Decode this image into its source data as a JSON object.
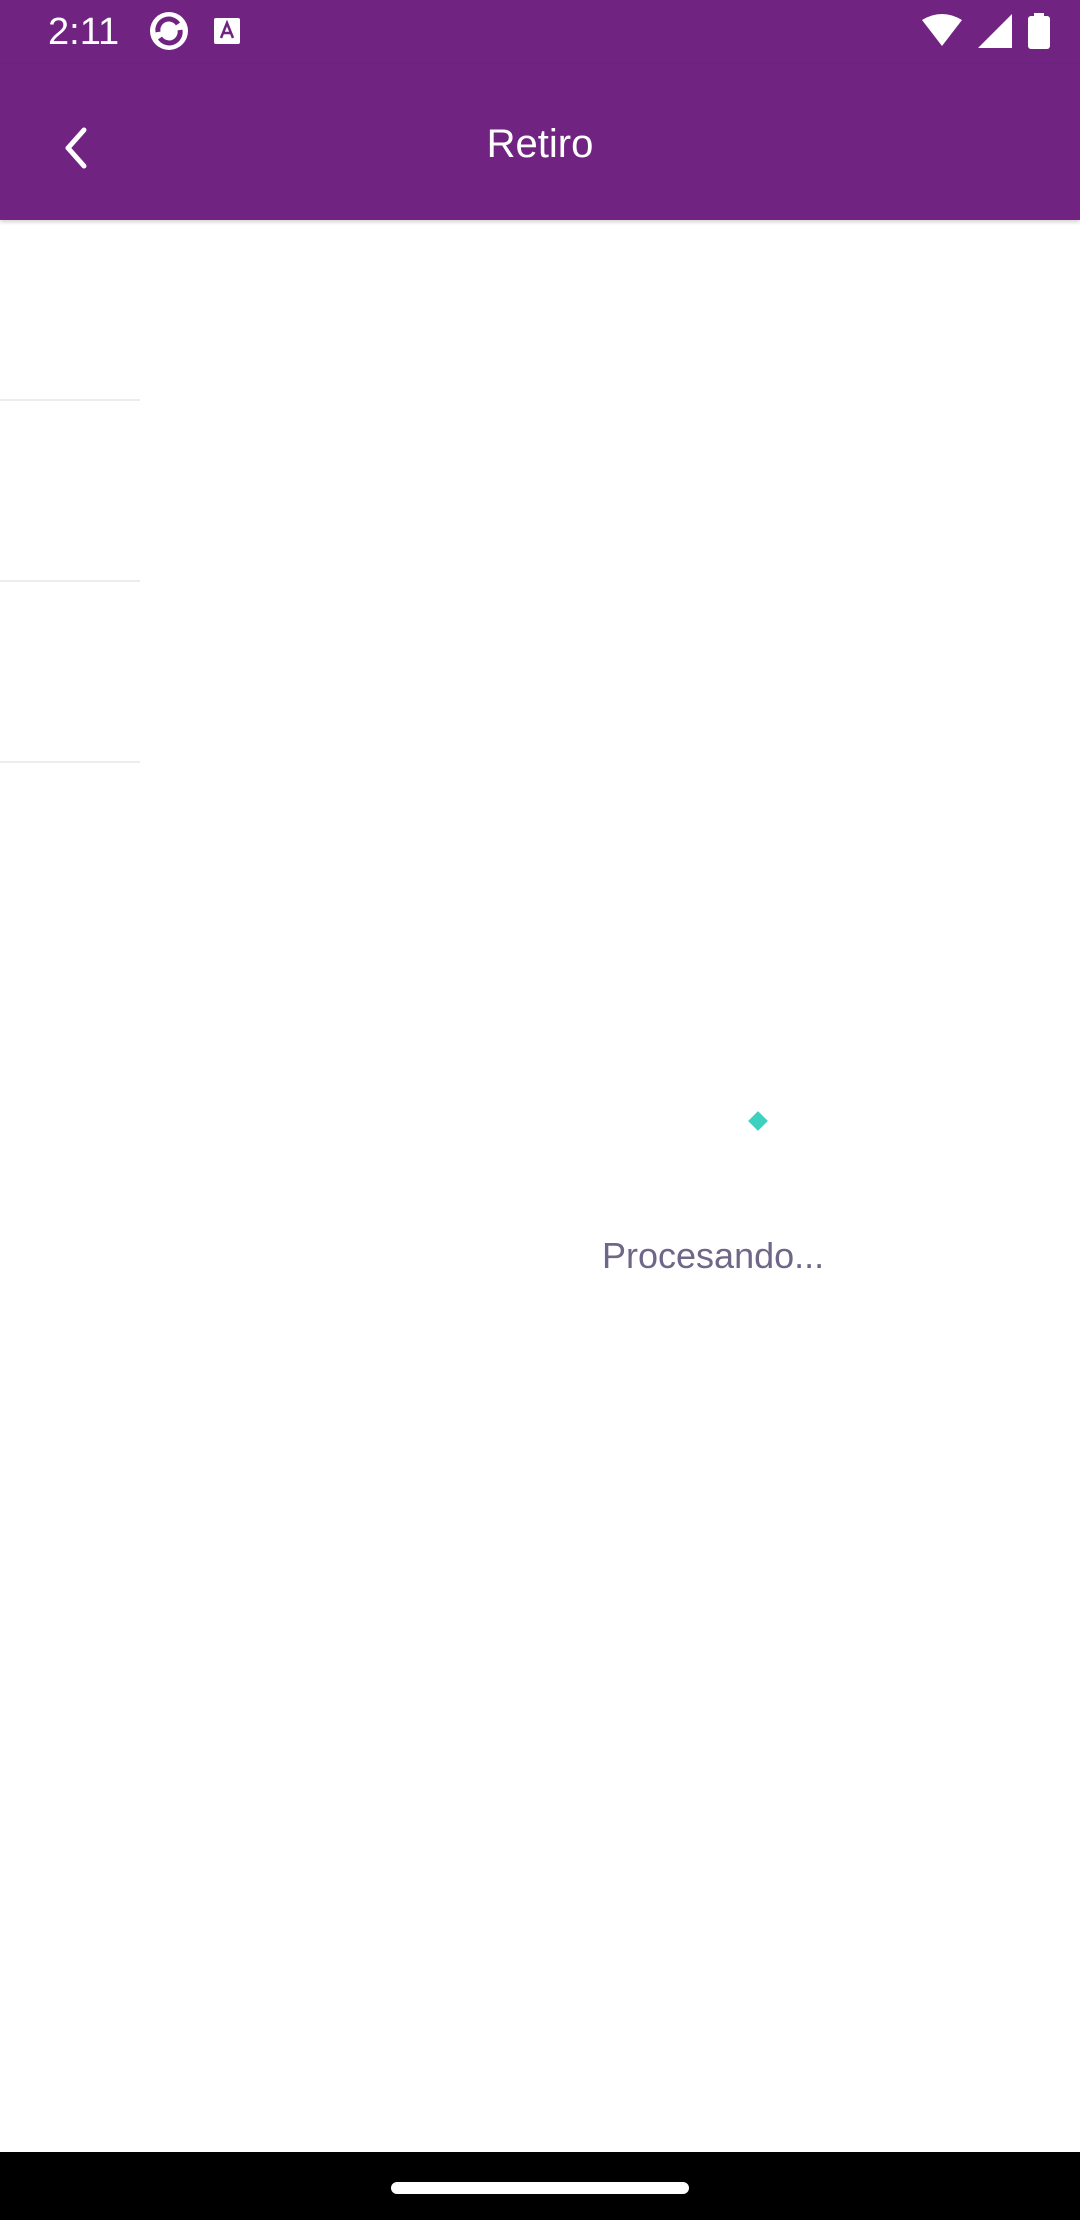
{
  "status_bar": {
    "time": "2:11",
    "notification_icons": [
      "sync-app-icon",
      "font-app-icon"
    ],
    "system_icons": [
      "wifi-icon",
      "cell-signal-icon",
      "battery-icon"
    ]
  },
  "app_bar": {
    "title": "Retiro",
    "back_icon": "chevron-left-icon"
  },
  "content": {
    "loading_text": "Procesando..."
  },
  "colors": {
    "primary": "#712382",
    "loader_accent": "#3fd1c0",
    "loading_text": "#6f6688"
  }
}
